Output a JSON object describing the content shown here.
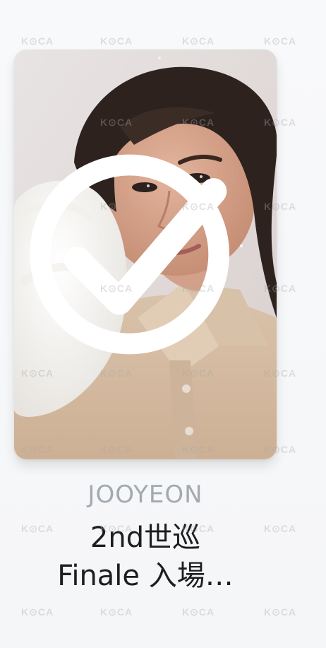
{
  "card": {
    "member_name": "JOOYEON",
    "title_line1": "2nd世巡",
    "title_line2": "Finale 入場…",
    "watermark": "K⊙CA",
    "check_icon": "check-circle-icon",
    "accent_check_color": "#ffffff"
  }
}
